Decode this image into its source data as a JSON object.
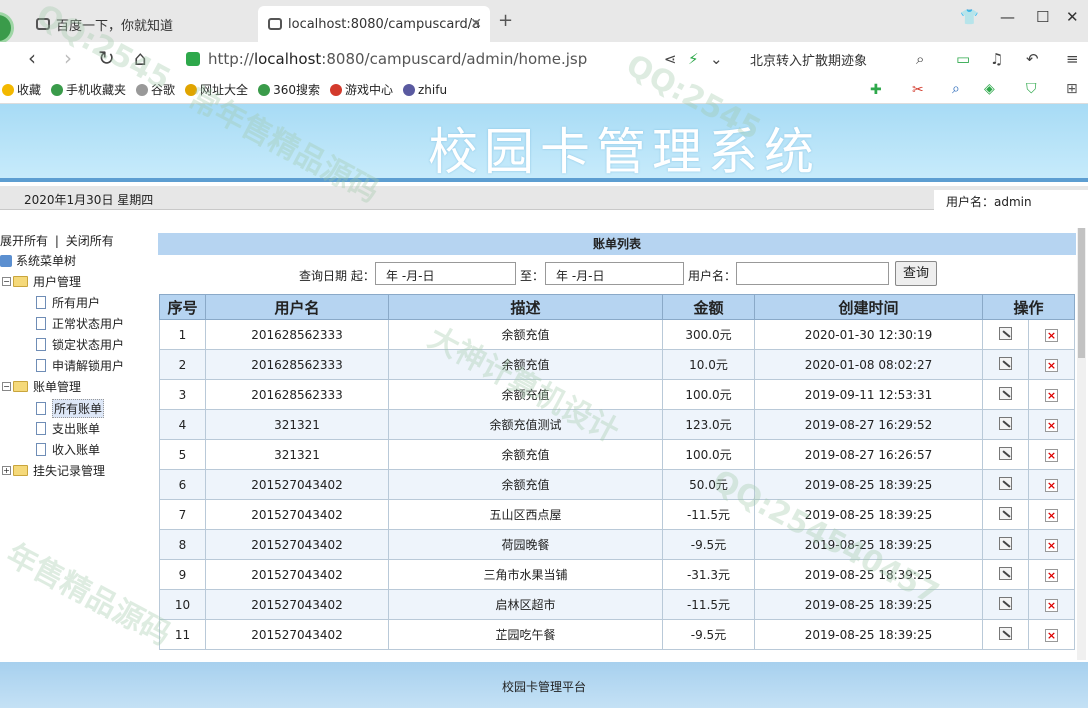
{
  "browser": {
    "tabs": [
      {
        "title": "百度一下，你就知道"
      },
      {
        "title": "localhost:8080/campuscard/a"
      }
    ],
    "url_prefix": "http://",
    "url_host": "localhost",
    "url_rest": ":8080/campuscard/admin/home.jsp",
    "search_text": "北京转入扩散期迹象",
    "bookmarks": [
      {
        "label": "收藏",
        "icon": "star-icon",
        "color": "#f3b800"
      },
      {
        "label": "手机收藏夹",
        "icon": "phone-icon",
        "color": "#3a9b4a"
      },
      {
        "label": "谷歌",
        "icon": "page-icon",
        "color": "#999999"
      },
      {
        "label": "网址大全",
        "icon": "globe-icon",
        "color": "#e0a400"
      },
      {
        "label": "360搜索",
        "icon": "search-icon",
        "color": "#3a9b4a"
      },
      {
        "label": "游戏中心",
        "icon": "game-icon",
        "color": "#d33a2c"
      },
      {
        "label": "zhifu",
        "icon": "globe-icon",
        "color": "#5a5aa0"
      }
    ]
  },
  "app": {
    "title": "校园卡管理系统",
    "date": "2020年1月30日 星期四",
    "user": "用户名：admin",
    "footer": "校园卡管理平台"
  },
  "sidebar": {
    "expand_all": "展开所有",
    "separator": "|",
    "collapse_all": "关闭所有",
    "root": "系统菜单树",
    "groups": [
      {
        "label": "用户管理",
        "items": [
          "所有用户",
          "正常状态用户",
          "锁定状态用户",
          "申请解锁用户"
        ]
      },
      {
        "label": "账单管理",
        "items": [
          "所有账单",
          "支出账单",
          "收入账单"
        ]
      },
      {
        "label": "挂失记录管理",
        "items": []
      }
    ]
  },
  "main": {
    "list_title": "账单列表",
    "query": {
      "date_label": "查询日期 起：",
      "date_from": "年 -月-日",
      "to_label": "至：",
      "date_to": "年 -月-日",
      "username_label": "用户名：",
      "username_value": "",
      "button": "查询"
    },
    "columns": [
      "序号",
      "用户名",
      "描述",
      "金额",
      "创建时间",
      "操作"
    ],
    "rows": [
      {
        "no": "1",
        "user": "201628562333",
        "desc": "余额充值",
        "amount": "300.0元",
        "time": "2020-01-30 12:30:19"
      },
      {
        "no": "2",
        "user": "201628562333",
        "desc": "余额充值",
        "amount": "10.0元",
        "time": "2020-01-08 08:02:27"
      },
      {
        "no": "3",
        "user": "201628562333",
        "desc": "余额充值",
        "amount": "100.0元",
        "time": "2019-09-11 12:53:31"
      },
      {
        "no": "4",
        "user": "321321",
        "desc": "余额充值测试",
        "amount": "123.0元",
        "time": "2019-08-27 16:29:52"
      },
      {
        "no": "5",
        "user": "321321",
        "desc": "余额充值",
        "amount": "100.0元",
        "time": "2019-08-27 16:26:57"
      },
      {
        "no": "6",
        "user": "201527043402",
        "desc": "余额充值",
        "amount": "50.0元",
        "time": "2019-08-25 18:39:25"
      },
      {
        "no": "7",
        "user": "201527043402",
        "desc": "五山区西点屋",
        "amount": "-11.5元",
        "time": "2019-08-25 18:39:25"
      },
      {
        "no": "8",
        "user": "201527043402",
        "desc": "荷园晚餐",
        "amount": "-9.5元",
        "time": "2019-08-25 18:39:25"
      },
      {
        "no": "9",
        "user": "201527043402",
        "desc": "三角市水果当铺",
        "amount": "-31.3元",
        "time": "2019-08-25 18:39:25"
      },
      {
        "no": "10",
        "user": "201527043402",
        "desc": "启林区超市",
        "amount": "-11.5元",
        "time": "2019-08-25 18:39:25"
      },
      {
        "no": "11",
        "user": "201527043402",
        "desc": "芷园吃午餐",
        "amount": "-9.5元",
        "time": "2019-08-25 18:39:25"
      }
    ]
  },
  "watermarks": [
    "QQ:2545",
    "常年售精品源码",
    "大神计算机设计",
    "QQ:2545",
    "年售精品源码",
    "QQ:254540457"
  ]
}
